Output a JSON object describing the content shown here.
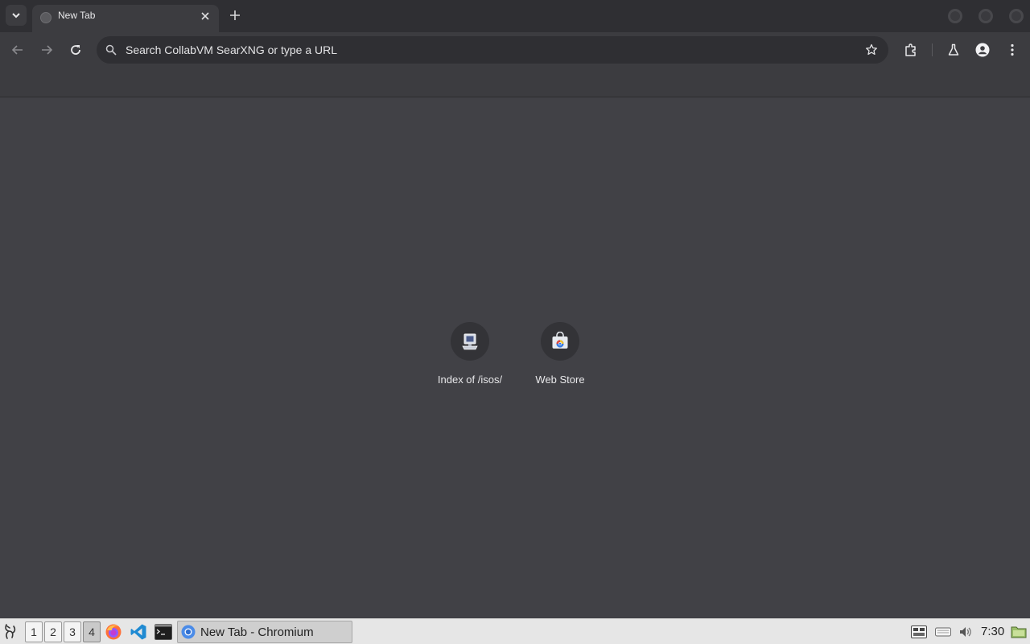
{
  "browser": {
    "tab_title": "New Tab",
    "omnibox_placeholder": "Search CollabVM SearXNG or type a URL",
    "shortcuts": [
      {
        "label": "Index of /isos/",
        "icon": "computer-icon"
      },
      {
        "label": "Web Store",
        "icon": "web-store-icon"
      }
    ]
  },
  "taskbar": {
    "workspaces": [
      "1",
      "2",
      "3",
      "4"
    ],
    "active_workspace": "4",
    "launchers": [
      "firefox-icon",
      "vscode-icon",
      "terminal-icon"
    ],
    "task_label": "New Tab - Chromium",
    "clock": "7:30"
  },
  "colors": {
    "page_bg": "#414146",
    "chrome_bg": "#3c3c40",
    "tabstrip_bg": "#2f2f33",
    "taskbar_bg": "#e6e6e6"
  }
}
